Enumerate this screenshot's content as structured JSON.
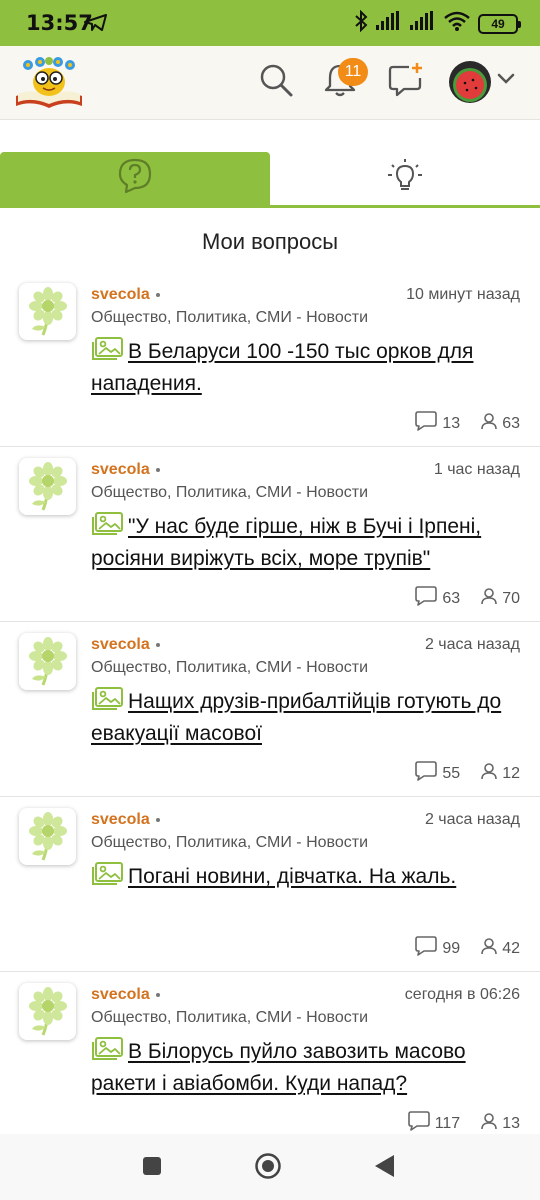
{
  "status_bar": {
    "time": "13:57",
    "battery": "49",
    "icons": [
      "telegram-icon",
      "bluetooth-icon",
      "signal-icon",
      "signal-icon",
      "wifi-icon",
      "battery-icon"
    ]
  },
  "header": {
    "notifications_count": "11",
    "icons": [
      "search-icon",
      "bell-icon",
      "new-question-icon",
      "chevron-down-icon"
    ],
    "accent_color": "#8fbf3f",
    "badge_color": "#f28c17"
  },
  "tabs": [
    {
      "name": "questions",
      "icon": "question-icon",
      "active": true
    },
    {
      "name": "ideas",
      "icon": "lightbulb-icon",
      "active": false
    }
  ],
  "section_title": "Мои вопросы",
  "questions": [
    {
      "author": "svecola",
      "time": "10 минут назад",
      "category": "Общество, Политика, СМИ - Новости",
      "title": "В Беларуси 100 -150 тыс орков для нападения.",
      "comments": "13",
      "followers": "63"
    },
    {
      "author": "svecola",
      "time": "1 час назад",
      "category": "Общество, Политика, СМИ - Новости",
      "title": "\"У нас буде гірше, ніж в Бучі і Ірпені, росіяни виріжуть всіх, море трупів\"",
      "comments": "63",
      "followers": "70"
    },
    {
      "author": "svecola",
      "time": "2 часа назад",
      "category": "Общество, Политика, СМИ - Новости",
      "title": "Нащих друзів-прибалтійців готують до евакуації масової",
      "comments": "55",
      "followers": "12"
    },
    {
      "author": "svecola",
      "time": "2 часа назад",
      "category": "Общество, Политика, СМИ - Новости",
      "title": "Погані новини, дівчатка. На жаль.",
      "comments": "99",
      "followers": "42"
    },
    {
      "author": "svecola",
      "time": "сегодня в 06:26",
      "category": "Общество, Политика, СМИ - Новости",
      "title": "В Білорусь пуйло завозить масово ракети і авіабомби. Куди напад?",
      "comments": "117",
      "followers": "13"
    }
  ],
  "nav_bar": {
    "icons": [
      "recents-square-icon",
      "home-circle-icon",
      "back-triangle-icon"
    ]
  }
}
